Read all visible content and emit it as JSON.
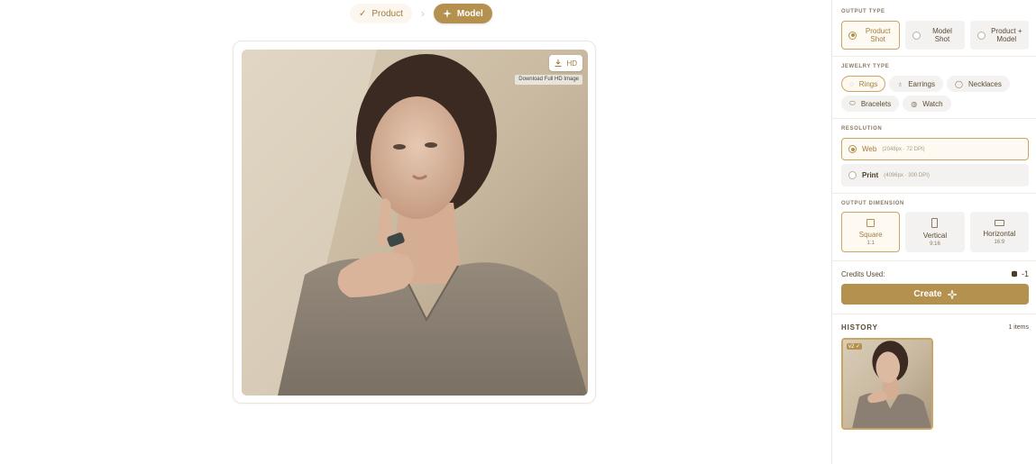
{
  "stepper": {
    "product_label": "Product",
    "model_label": "Model"
  },
  "preview": {
    "hd_label": "HD",
    "tooltip": "Download Full HD Image"
  },
  "output_type": {
    "label": "OUTPUT TYPE",
    "options": [
      {
        "line1": "Product",
        "line2": "Shot",
        "selected": true
      },
      {
        "line1": "Model",
        "line2": "Shot",
        "selected": false
      },
      {
        "line1": "Product +",
        "line2": "Model",
        "selected": false
      }
    ]
  },
  "jewelry_type": {
    "label": "JEWELRY TYPE",
    "chips": [
      {
        "label": "Rings",
        "icon": "ring-icon",
        "selected": true
      },
      {
        "label": "Earrings",
        "icon": "earring-icon",
        "selected": false
      },
      {
        "label": "Necklaces",
        "icon": "necklace-icon",
        "selected": false
      },
      {
        "label": "Bracelets",
        "icon": "bracelet-icon",
        "selected": false
      },
      {
        "label": "Watch",
        "icon": "watch-icon",
        "selected": false
      }
    ]
  },
  "resolution": {
    "label": "RESOLUTION",
    "options": [
      {
        "name": "Web",
        "meta": "(2048px · 72 DPI)",
        "selected": true
      },
      {
        "name": "Print",
        "meta": "(4096px · 300 DPI)",
        "selected": false
      }
    ]
  },
  "output_dimension": {
    "label": "OUTPUT DIMENSION",
    "options": [
      {
        "label": "Square",
        "ratio": "1:1",
        "selected": true
      },
      {
        "label": "Vertical",
        "ratio": "9:16",
        "selected": false
      },
      {
        "label": "Horizontal",
        "ratio": "16:9",
        "selected": false
      }
    ]
  },
  "credits": {
    "label": "Credits Used:",
    "value": "-1"
  },
  "create_label": "Create",
  "history": {
    "title": "HISTORY",
    "count": "1 items",
    "items": [
      {
        "tag": "v2 ✓"
      }
    ]
  },
  "colors": {
    "accent": "#b4914e",
    "accent_text": "#a27c3d",
    "selected_bg": "#fffaf1",
    "option_bg": "#f3f2f0"
  }
}
